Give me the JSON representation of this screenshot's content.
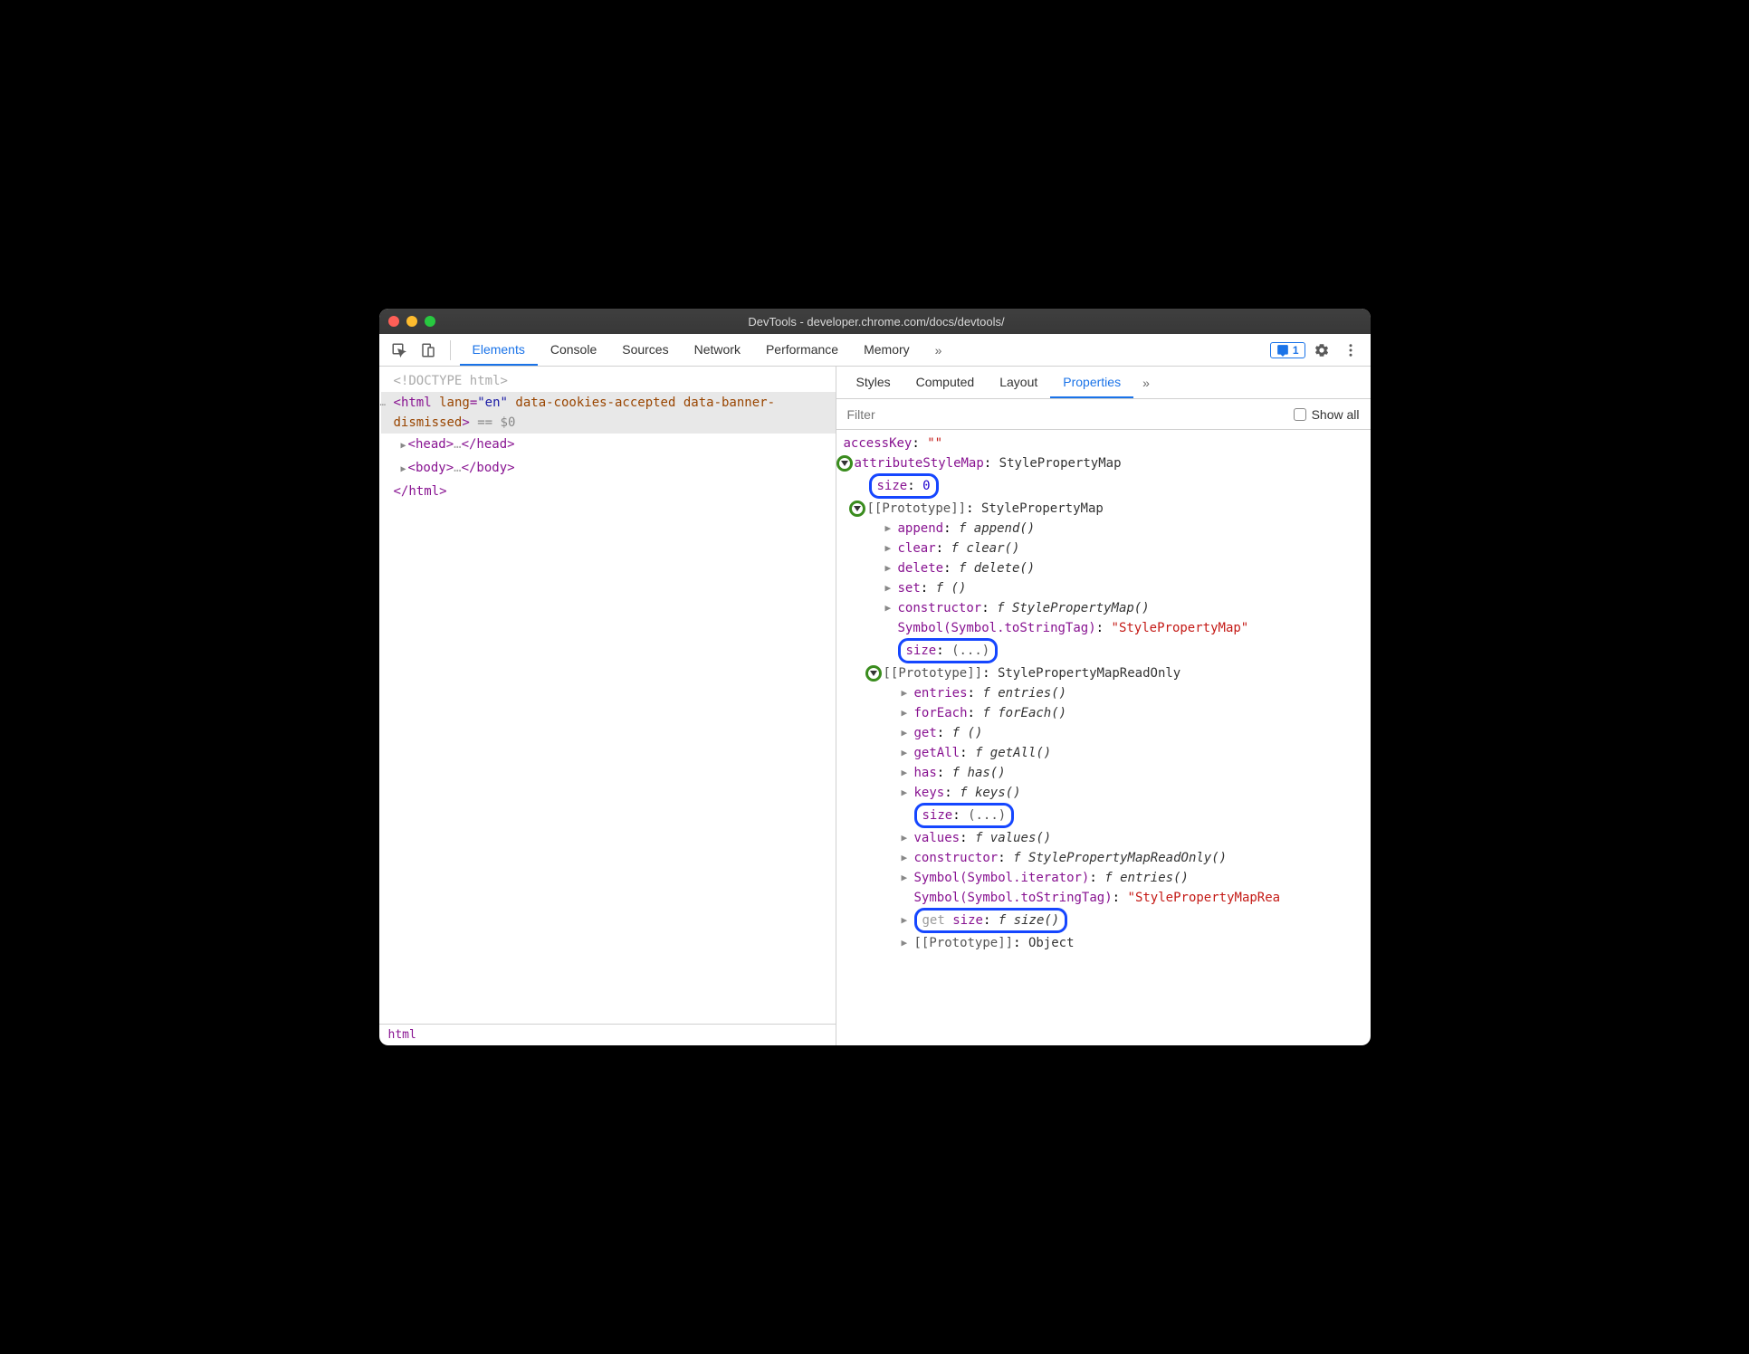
{
  "window": {
    "title": "DevTools - developer.chrome.com/docs/devtools/"
  },
  "mainTabs": [
    "Elements",
    "Console",
    "Sources",
    "Network",
    "Performance",
    "Memory"
  ],
  "mainTabActive": 0,
  "issuesCount": "1",
  "dom": {
    "doctype": "<!DOCTYPE html>",
    "htmlOpen": "<html lang=\"en\" data-cookies-accepted data-banner-dismissed>",
    "selSuffix": " == $0",
    "head": "<head>…</head>",
    "body": "<body>…</body>",
    "htmlClose": "</html>"
  },
  "breadcrumb": "html",
  "subTabs": [
    "Styles",
    "Computed",
    "Layout",
    "Properties"
  ],
  "subTabActive": 3,
  "filter": {
    "placeholder": "Filter",
    "showAll": "Show all"
  },
  "props": {
    "accessKey": {
      "k": "accessKey",
      "v": "\"\""
    },
    "attributeStyleMap": {
      "k": "attributeStyleMap",
      "v": "StylePropertyMap"
    },
    "size": {
      "k": "size",
      "v": "0"
    },
    "proto1": {
      "k": "[[Prototype]]",
      "v": "StylePropertyMap"
    },
    "append": {
      "k": "append",
      "fn": "append()"
    },
    "clear": {
      "k": "clear",
      "fn": "clear()"
    },
    "delete": {
      "k": "delete",
      "fn": "delete()"
    },
    "set": {
      "k": "set",
      "fn": "()"
    },
    "ctor1": {
      "k": "constructor",
      "fn": "StylePropertyMap()"
    },
    "symTag1": {
      "k": "Symbol(Symbol.toStringTag)",
      "v": "\"StylePropertyMap\""
    },
    "sizeLazy1": {
      "k": "size",
      "v": "(...)"
    },
    "proto2": {
      "k": "[[Prototype]]",
      "v": "StylePropertyMapReadOnly"
    },
    "entries": {
      "k": "entries",
      "fn": "entries()"
    },
    "forEach": {
      "k": "forEach",
      "fn": "forEach()"
    },
    "get": {
      "k": "get",
      "fn": "()"
    },
    "getAll": {
      "k": "getAll",
      "fn": "getAll()"
    },
    "has": {
      "k": "has",
      "fn": "has()"
    },
    "keys": {
      "k": "keys",
      "fn": "keys()"
    },
    "sizeLazy2": {
      "k": "size",
      "v": "(...)"
    },
    "values": {
      "k": "values",
      "fn": "values()"
    },
    "ctor2": {
      "k": "constructor",
      "fn": "StylePropertyMapReadOnly()"
    },
    "symIter": {
      "k": "Symbol(Symbol.iterator)",
      "fn": "entries()"
    },
    "symTag2": {
      "k": "Symbol(Symbol.toStringTag)",
      "v": "\"StylePropertyMapRea"
    },
    "getSize": {
      "k": "get size",
      "fn": "size()"
    },
    "proto3": {
      "k": "[[Prototype]]",
      "v": "Object"
    }
  }
}
